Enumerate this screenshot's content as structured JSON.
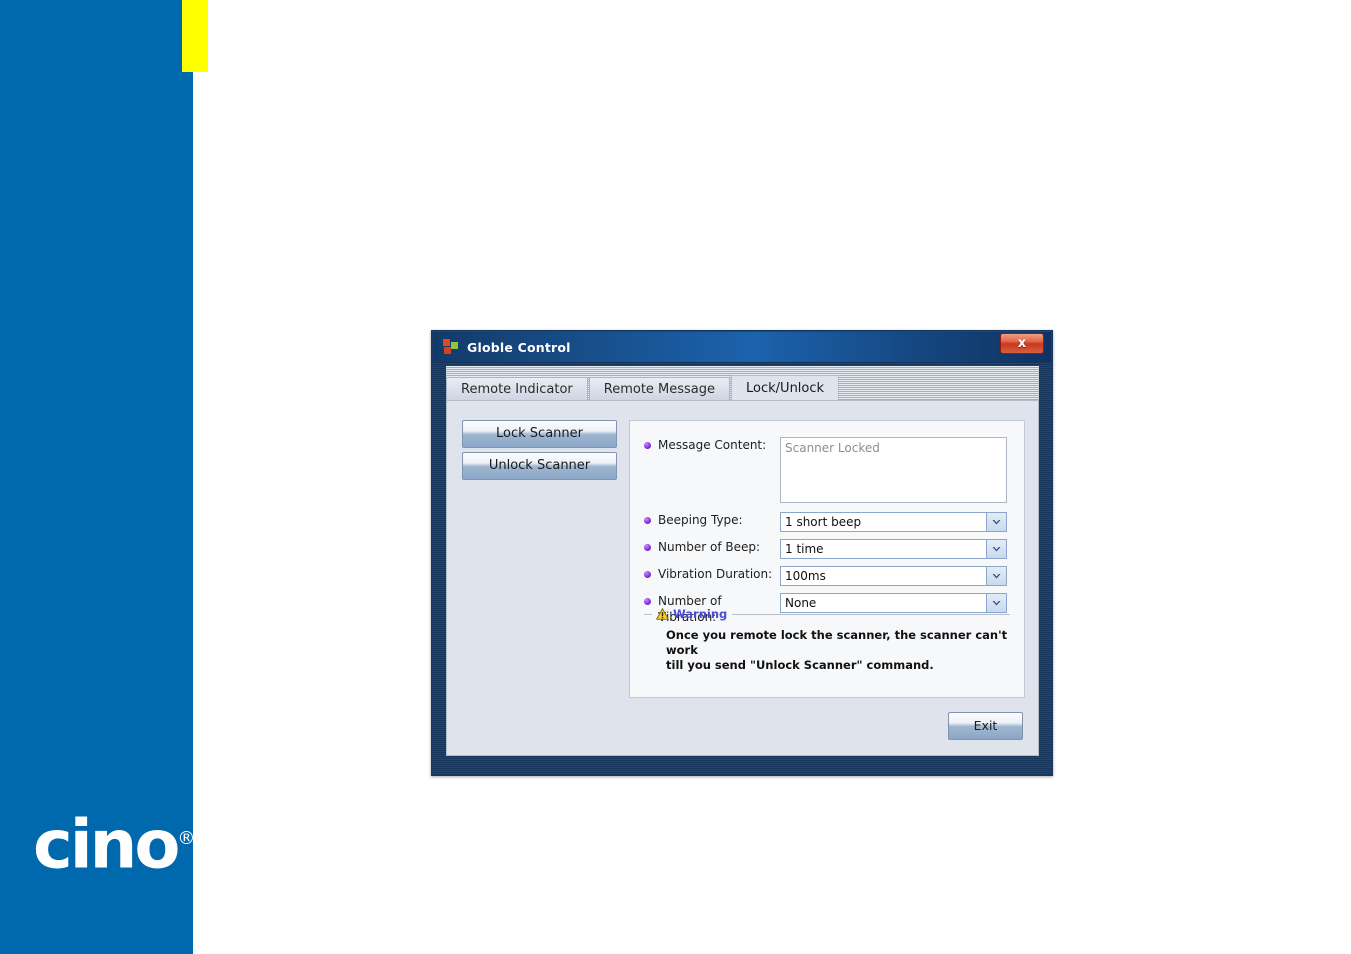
{
  "page": {
    "brand_logo_text": "cino",
    "brand_logo_mark": "®",
    "sidebar_color": "#0069ae",
    "accent_color": "#ffff00"
  },
  "dialog": {
    "title": "Globle Control",
    "close_label": "x",
    "tabs": [
      {
        "label": "Remote Indicator",
        "active": false
      },
      {
        "label": "Remote Message",
        "active": false
      },
      {
        "label": "Lock/Unlock",
        "active": true
      }
    ],
    "actions": [
      {
        "label": "Lock Scanner"
      },
      {
        "label": "Unlock Scanner"
      }
    ],
    "fields": {
      "message_content": {
        "label": "Message Content:",
        "value": "Scanner Locked",
        "placeholder": "Scanner Locked"
      },
      "beeping_type": {
        "label": "Beeping Type:",
        "value": "1 short beep"
      },
      "number_of_beep": {
        "label": "Number of Beep:",
        "value": "1 time"
      },
      "vibration_duration": {
        "label": "Vibration Duration:",
        "value": "100ms"
      },
      "number_of_vibration": {
        "label": "Number of Vibration:",
        "value": "None"
      }
    },
    "warning": {
      "title": "Warning",
      "line1": "Once you remote lock the scanner, the scanner can't work",
      "line2": "till you send \"Unlock Scanner\" command.",
      "title_color": "#4b4bd8"
    },
    "exit_label": "Exit"
  }
}
